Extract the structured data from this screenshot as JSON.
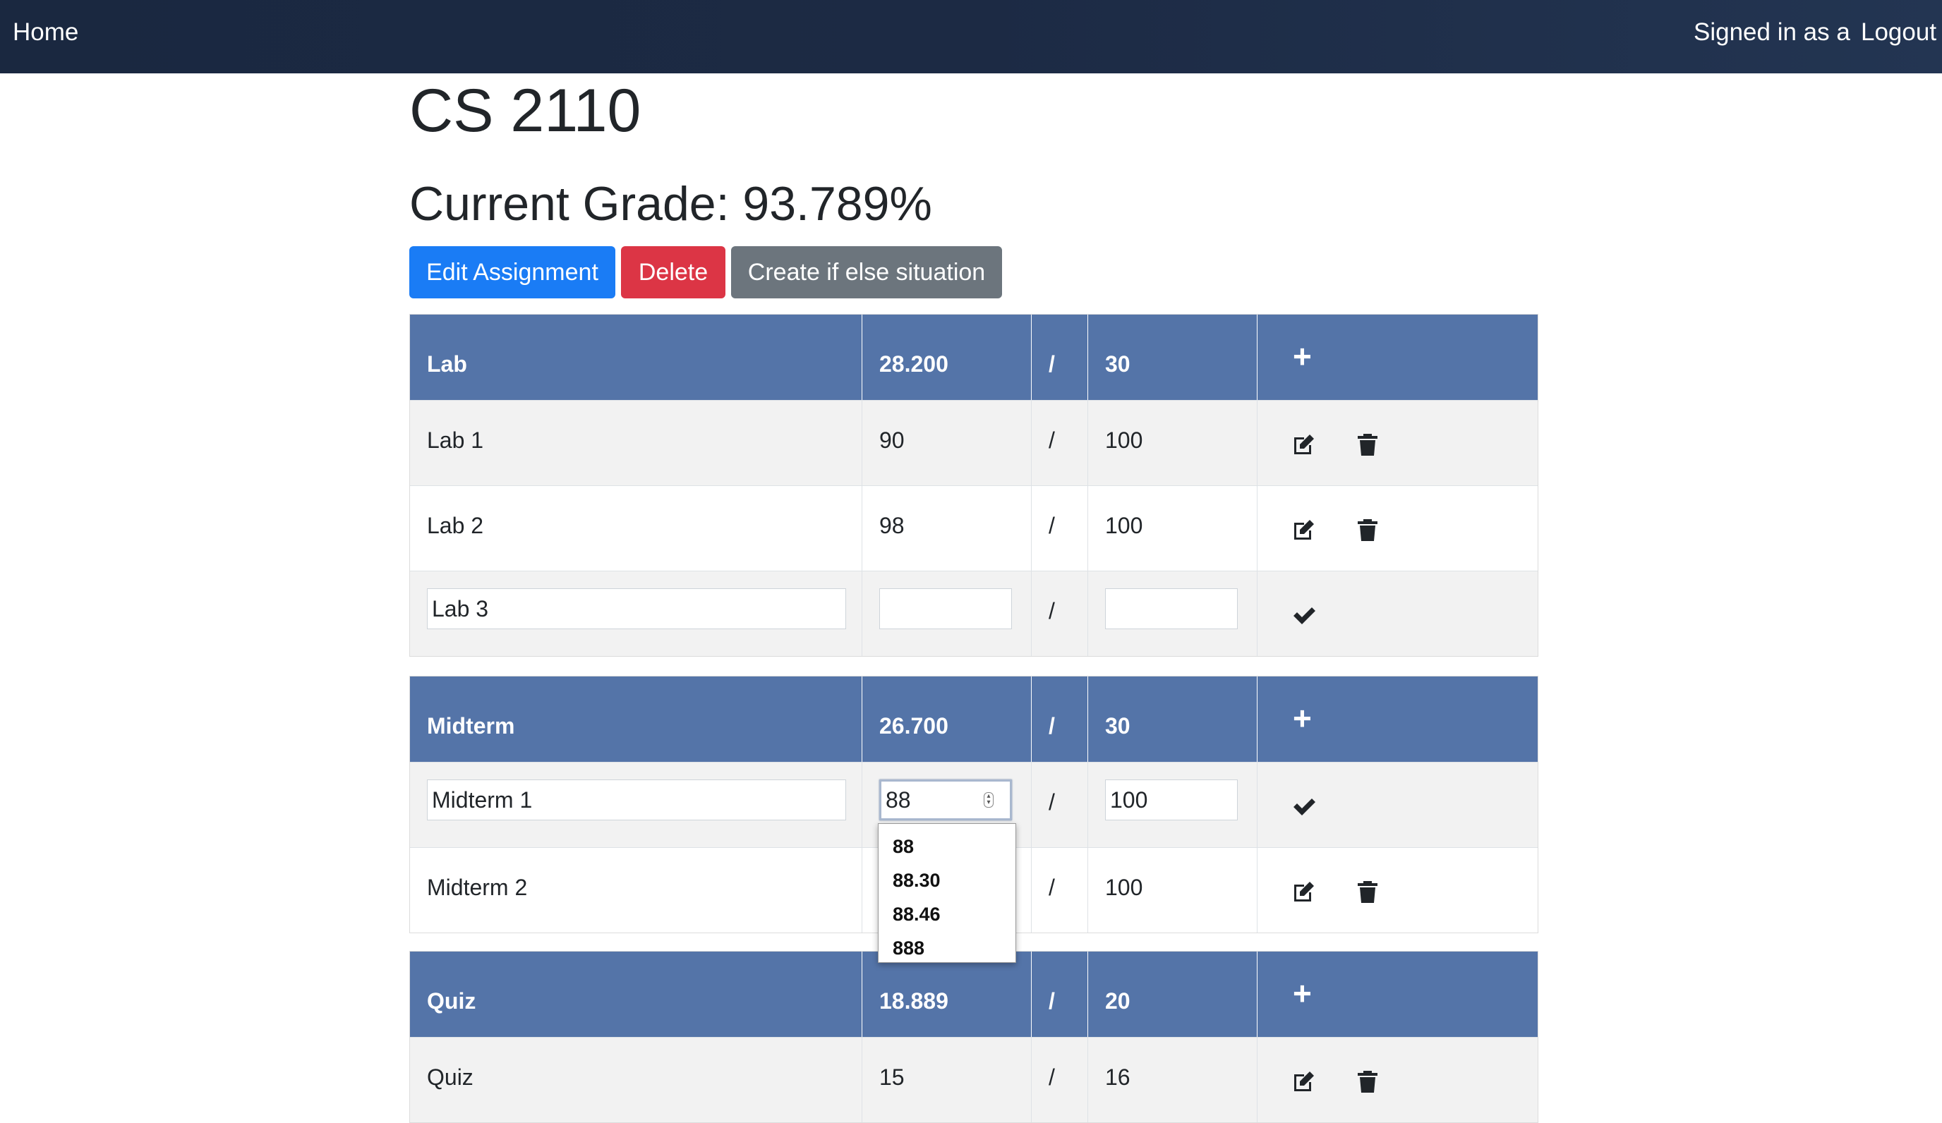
{
  "nav": {
    "home": "Home",
    "signed_in": "Signed in as a",
    "logout": "Logout"
  },
  "course": {
    "title": "CS 2110",
    "grade": "Current Grade: 93.789%"
  },
  "buttons": {
    "edit": "Edit Assignment",
    "delete": "Delete",
    "create": "Create if else situation"
  },
  "sections": [
    {
      "name": "Lab",
      "score": "28.200",
      "slash": "/",
      "total": "30",
      "add": "+",
      "rows": [
        {
          "name": "Lab 1",
          "score": "90",
          "slash": "/",
          "total": "100"
        },
        {
          "name": "Lab 2",
          "score": "98",
          "slash": "/",
          "total": "100"
        },
        {
          "name_value": "Lab 3",
          "score_value": "",
          "slash": "/",
          "total_value": ""
        }
      ]
    },
    {
      "name": "Midterm",
      "score": "26.700",
      "slash": "/",
      "total": "30",
      "add": "+",
      "rows": [
        {
          "name_value": "Midterm 1",
          "score_value": "88",
          "slash": "/",
          "total_value": "100"
        },
        {
          "name": "Midterm 2",
          "score": "",
          "slash": "/",
          "total": "100"
        }
      ]
    },
    {
      "name": "Quiz",
      "score": "18.889",
      "slash": "/",
      "total": "20",
      "add": "+",
      "rows": [
        {
          "name": "Quiz",
          "score": "15",
          "slash": "/",
          "total": "16"
        }
      ]
    }
  ],
  "autocomplete": [
    "88",
    "88.30",
    "88.46",
    "888"
  ],
  "icons": {
    "edit": "edit-icon",
    "trash": "trash-icon",
    "check": "check-icon",
    "plus": "plus-icon"
  },
  "colors": {
    "navbar": "#1c2a44",
    "header": "#5474a8",
    "primary": "#1a7cf5",
    "danger": "#dc3545",
    "secondary": "#6c757d"
  }
}
